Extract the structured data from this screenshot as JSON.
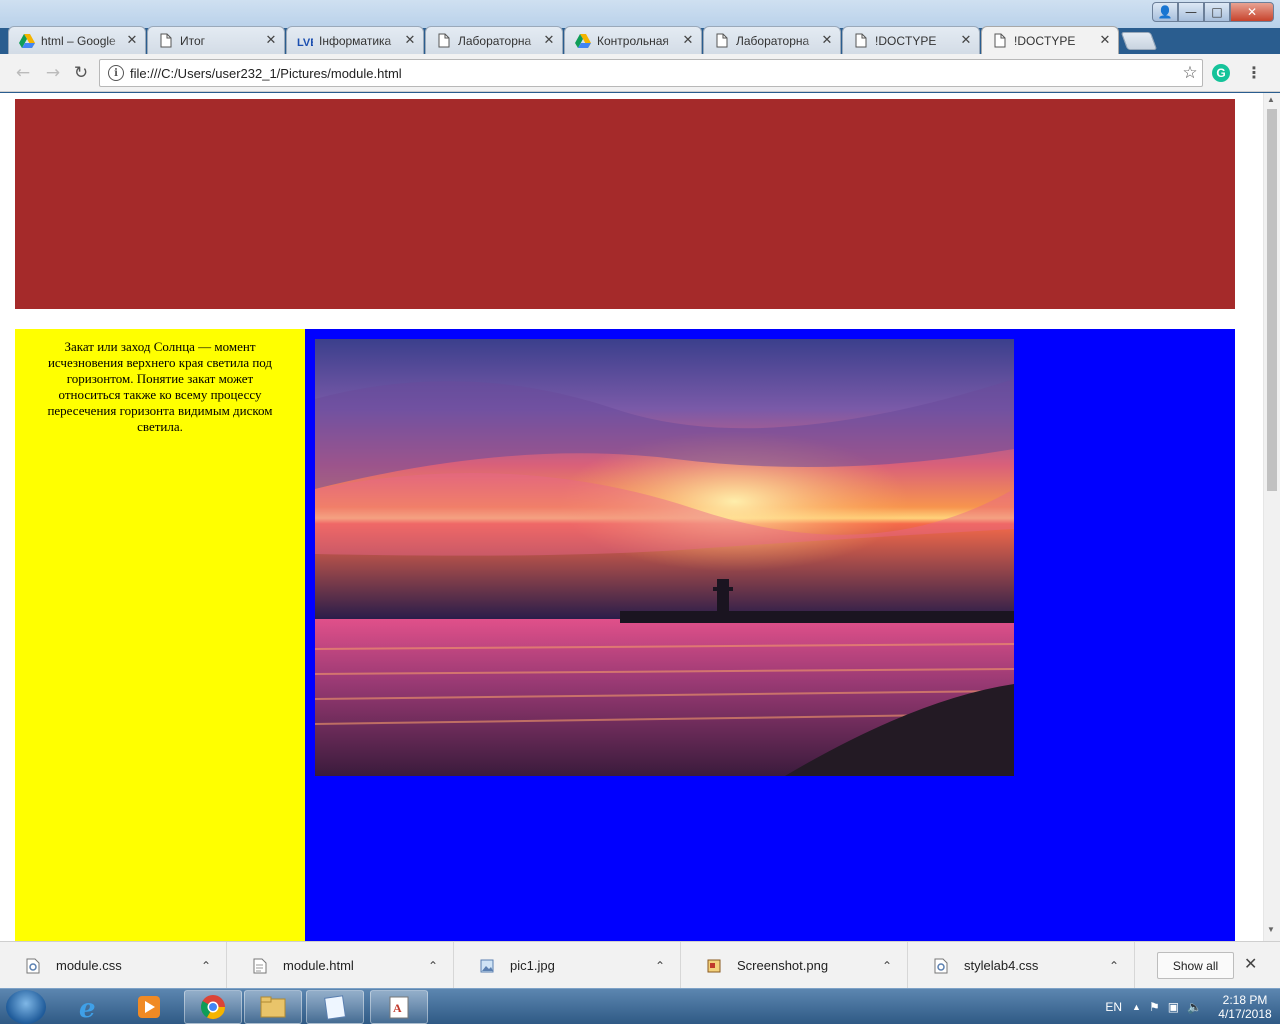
{
  "tabs": [
    {
      "label": "html – Google",
      "icon": "google-drive-icon"
    },
    {
      "label": "Итог",
      "icon": "document-icon"
    },
    {
      "label": "Інформатика",
      "icon": "lvb-icon"
    },
    {
      "label": "Лабораторна",
      "icon": "document-icon"
    },
    {
      "label": "Контрольная",
      "icon": "google-drive-icon"
    },
    {
      "label": "Лабораторна",
      "icon": "document-icon"
    },
    {
      "label": "!DOCTYPE",
      "icon": "document-icon"
    },
    {
      "label": "!DOCTYPE",
      "icon": "document-icon"
    }
  ],
  "omnibox": {
    "url": "file:///C:/Users/user232_1/Pictures/module.html"
  },
  "page": {
    "header_color": "#a52a2a",
    "left_color": "#ffff00",
    "right_color": "#0000ff",
    "sidebar_text": "Закат или заход Солнца — момент исчезновения верхнего края светила под горизонтом. Понятие закат может относиться также ко всему процессу пересечения горизонта видимым диском светила."
  },
  "downloads": [
    {
      "name": "module.css",
      "icon": "css-file-icon"
    },
    {
      "name": "module.html",
      "icon": "html-file-icon"
    },
    {
      "name": "pic1.jpg",
      "icon": "image-file-icon"
    },
    {
      "name": "Screenshot.png",
      "icon": "image-file-icon"
    },
    {
      "name": "stylelab4.css",
      "icon": "css-file-icon"
    }
  ],
  "shelf": {
    "show_all": "Show all"
  },
  "taskbar": {
    "lang": "EN",
    "time": "2:18 PM",
    "date": "4/17/2018"
  }
}
